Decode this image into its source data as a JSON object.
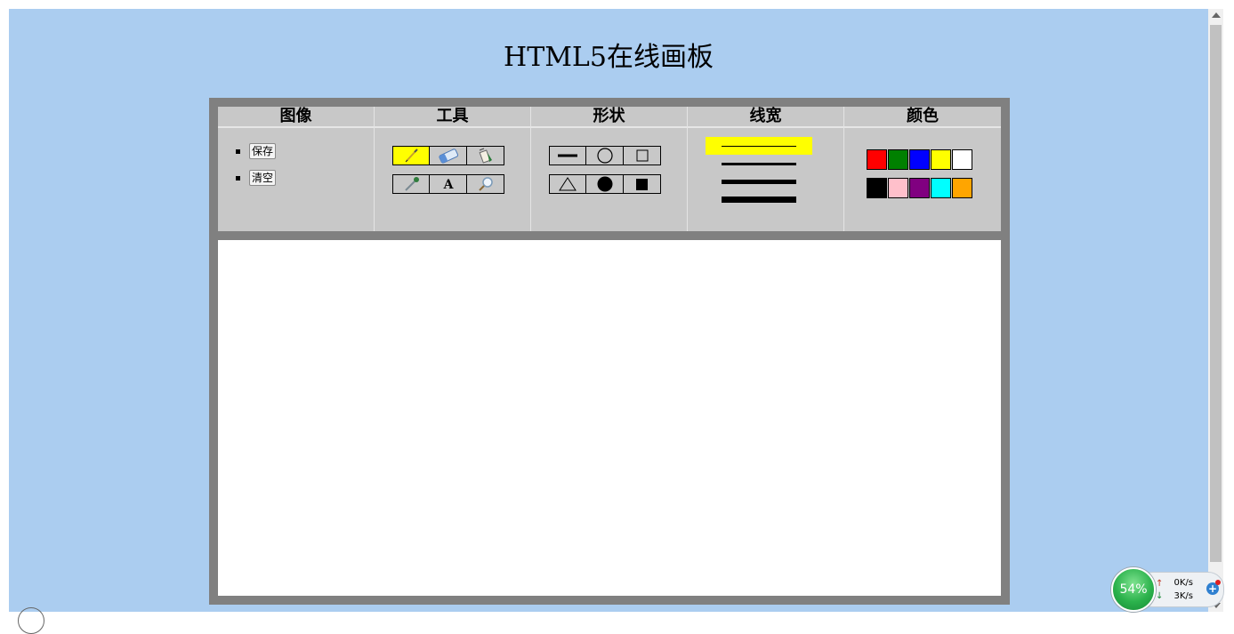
{
  "page": {
    "title": "HTML5在线画板"
  },
  "toolbar": {
    "image": {
      "header": "图像",
      "save_label": "保存",
      "clear_label": "清空"
    },
    "tools": {
      "header": "工具",
      "items": [
        "pencil",
        "eraser",
        "paint-bucket",
        "eyedropper",
        "text",
        "magnifier"
      ],
      "active": "pencil"
    },
    "shapes": {
      "header": "形状",
      "items": [
        "line",
        "circle-outline",
        "square-outline",
        "triangle-outline",
        "circle-filled",
        "square-filled"
      ]
    },
    "line_width": {
      "header": "线宽",
      "options": [
        1,
        3,
        5,
        7
      ],
      "selected": 1
    },
    "colors": {
      "header": "颜色",
      "swatches": [
        "#ff0000",
        "#008000",
        "#0000ff",
        "#ffff00",
        "#ffffff",
        "#000000",
        "#ffc0cb",
        "#800080",
        "#00ffff",
        "#ffa500"
      ]
    }
  },
  "colors": {
    "page_bg": "#abcdf0",
    "board_frame": "#808080",
    "toolbar_bg": "#c8c8c8",
    "highlight": "#ffff00"
  },
  "network_widget": {
    "usage": "54%",
    "upload": "0K/s",
    "download": "3K/s"
  }
}
